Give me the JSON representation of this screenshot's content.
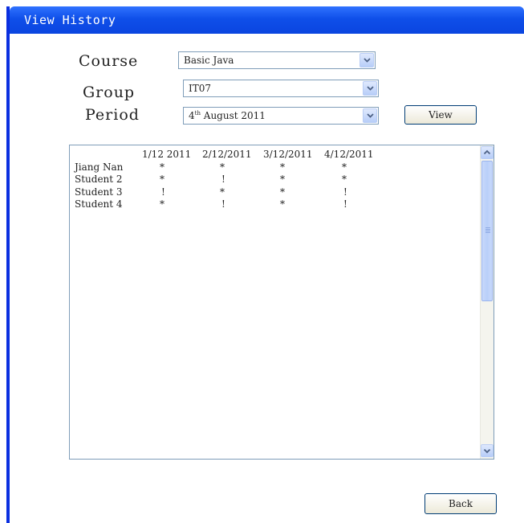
{
  "window": {
    "title": "View History",
    "accent": "#0a45e0"
  },
  "form": {
    "course_label": "Course",
    "course_value": "Basic Java",
    "group_label": "Group",
    "group_value": "IT07",
    "period_label": "Period",
    "period_day": "4",
    "period_suffix": "th",
    "period_rest": " August 2011",
    "view_button": "View"
  },
  "table": {
    "headers": [
      "1/12 2011",
      "2/12/2011",
      "3/12/2011",
      "4/12/2011"
    ],
    "rows": [
      {
        "name": "Jiang Nan",
        "cells": [
          "*",
          "*",
          "*",
          "*"
        ]
      },
      {
        "name": "Student 2",
        "cells": [
          "*",
          "!",
          "*",
          "*"
        ]
      },
      {
        "name": "Student 3",
        "cells": [
          "!",
          "*",
          "*",
          "!"
        ]
      },
      {
        "name": "Student 4",
        "cells": [
          "*",
          "!",
          "*",
          "!"
        ]
      }
    ]
  },
  "footer": {
    "back_button": "Back"
  },
  "icons": {
    "dropdown": "chevron-down-icon",
    "scroll_up": "arrow-up-icon",
    "scroll_down": "arrow-down-icon"
  }
}
